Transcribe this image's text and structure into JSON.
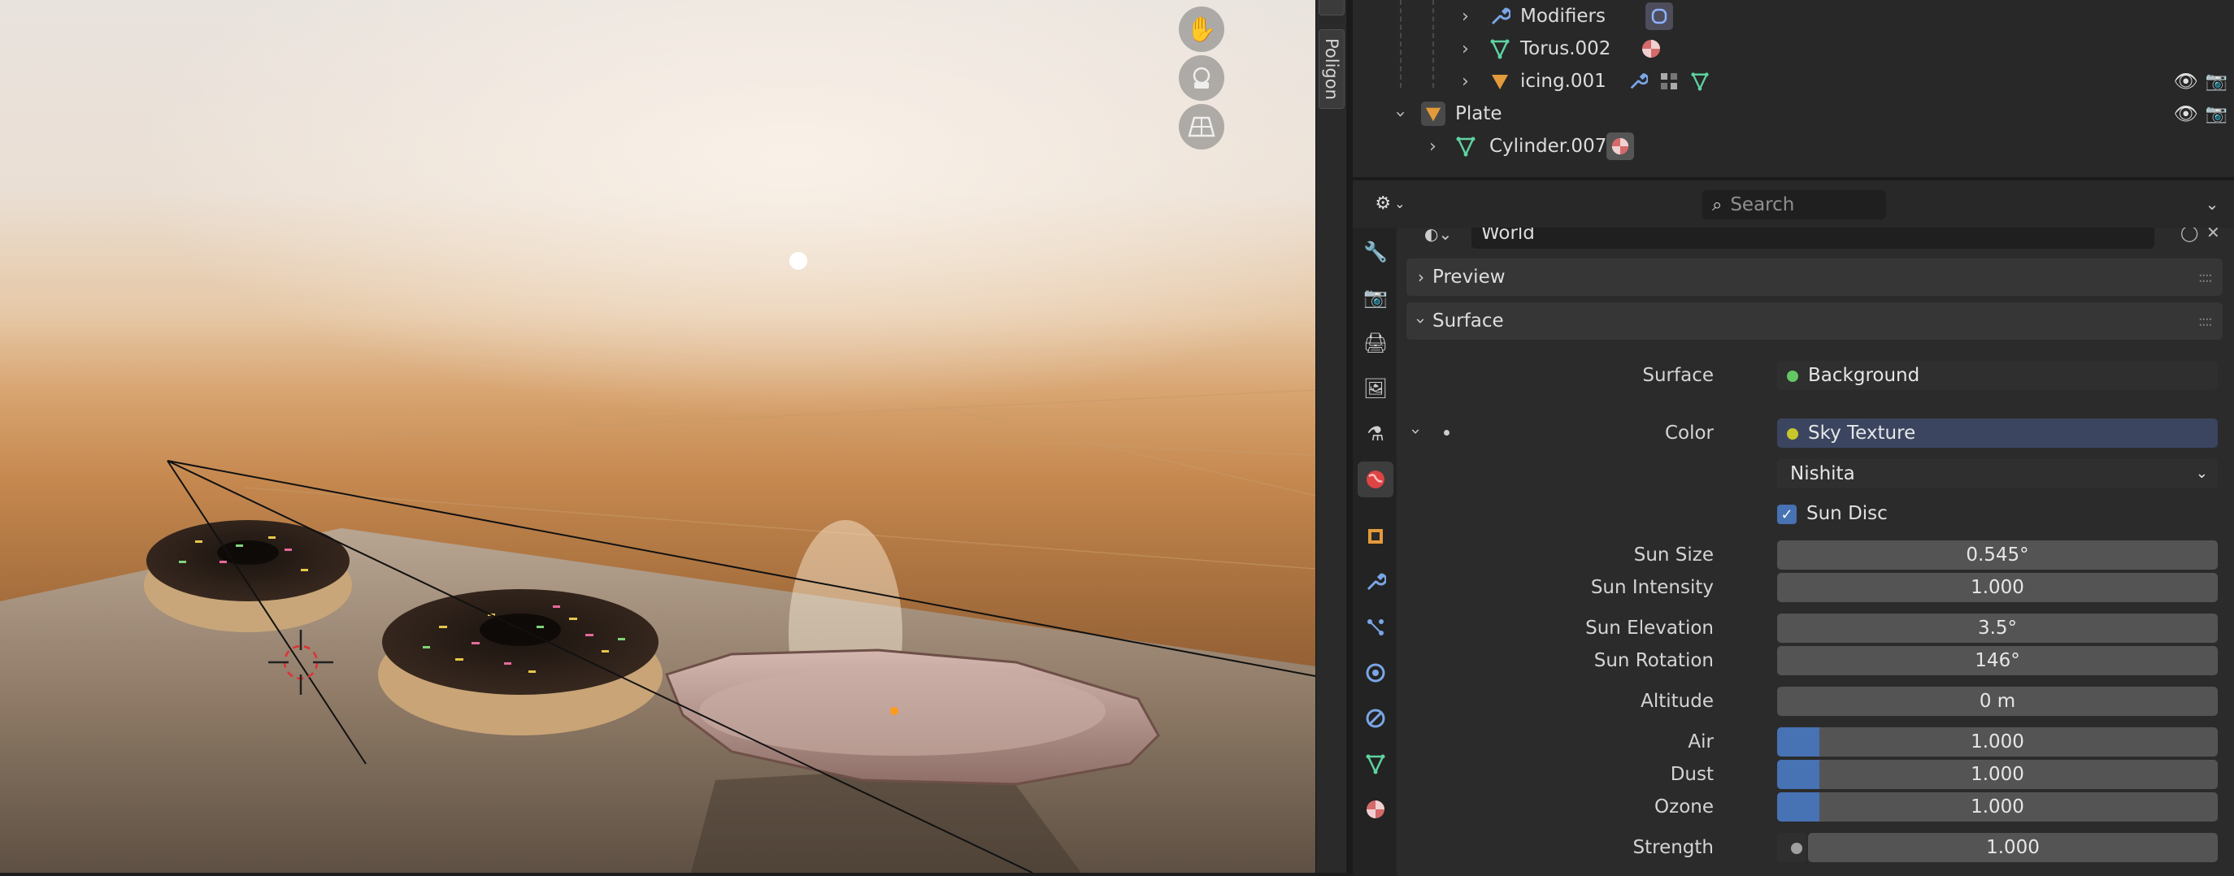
{
  "viewport": {
    "side_tab_label": "Poligon",
    "nav": {
      "pan_icon": "hand-icon",
      "camera_icon": "camera-orbit-icon",
      "view_icon": "perspective-grid-icon"
    }
  },
  "outliner": {
    "rows": [
      {
        "label": "Modifiers",
        "icon": "wrench-icon"
      },
      {
        "label": "Torus.002",
        "icon": "mesh-icon"
      },
      {
        "label": "icing.001",
        "icon": "object-icon"
      },
      {
        "label": "Plate",
        "icon": "object-icon"
      },
      {
        "label": "Cylinder.007",
        "icon": "mesh-icon"
      }
    ]
  },
  "properties": {
    "search_placeholder": "Search",
    "world_name": "World",
    "panels": {
      "preview": "Preview",
      "surface": "Surface"
    },
    "surface": {
      "surface_label": "Surface",
      "surface_value": "Background",
      "color_label": "Color",
      "color_value": "Sky Texture",
      "sky_type": "Nishita",
      "sun_disc_label": "Sun Disc",
      "sun_disc_checked": true,
      "sun_size_label": "Sun Size",
      "sun_size": "0.545°",
      "sun_intensity_label": "Sun Intensity",
      "sun_intensity": "1.000",
      "sun_elevation_label": "Sun Elevation",
      "sun_elevation": "3.5°",
      "sun_rotation_label": "Sun Rotation",
      "sun_rotation": "146°",
      "altitude_label": "Altitude",
      "altitude": "0 m",
      "air_label": "Air",
      "air": "1.000",
      "dust_label": "Dust",
      "dust": "1.000",
      "ozone_label": "Ozone",
      "ozone": "1.000",
      "strength_label": "Strength",
      "strength": "1.000"
    },
    "colors": {
      "shader_socket_green": "#63c763",
      "color_socket_yellow": "#c7c729",
      "accent_blue": "#4772b3"
    }
  }
}
